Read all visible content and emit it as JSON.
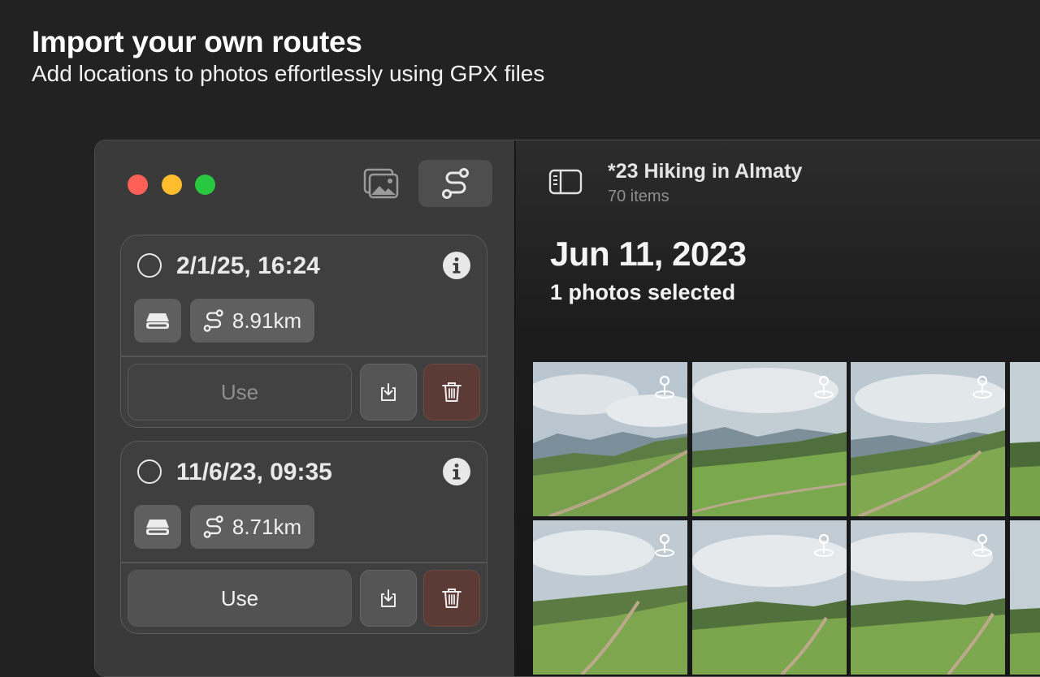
{
  "promo": {
    "title": "Import your own routes",
    "subtitle": "Add locations to photos effortlessly using GPX files"
  },
  "sidebar": {
    "toolbar": {
      "photos_icon": "photos-icon",
      "routes_icon": "route-icon",
      "active": "routes"
    },
    "routes": [
      {
        "date": "2/1/25, 16:24",
        "distance": "8.91km",
        "use_label": "Use",
        "use_enabled": false,
        "selected": false
      },
      {
        "date": "11/6/23, 09:35",
        "distance": "8.71km",
        "use_label": "Use",
        "use_enabled": true,
        "selected": false
      }
    ]
  },
  "main": {
    "album_title": "*23 Hiking in Almaty",
    "album_count": "70 items",
    "date_header": "Jun 11, 2023",
    "selection_status": "1 photos selected",
    "photos": [
      {
        "has_location": true
      },
      {
        "has_location": true
      },
      {
        "has_location": true
      },
      {
        "has_location": false
      },
      {
        "has_location": true
      },
      {
        "has_location": true
      },
      {
        "has_location": true
      },
      {
        "has_location": false
      }
    ]
  },
  "colors": {
    "close": "#fe5f57",
    "minimize": "#febc2e",
    "zoom": "#28c840",
    "delete_bg": "#5c3a36"
  }
}
